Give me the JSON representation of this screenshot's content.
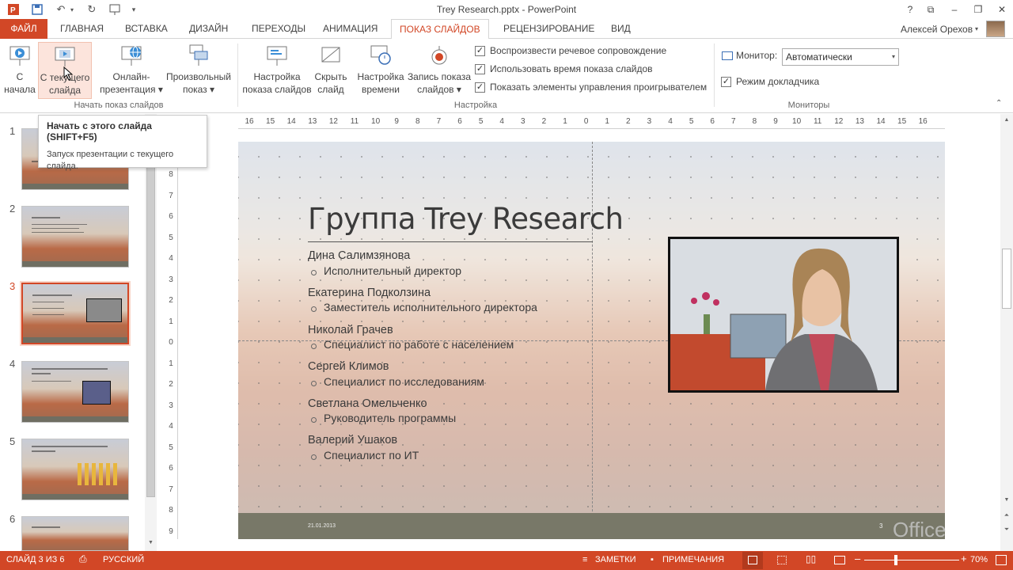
{
  "window": {
    "title": "Trey Research.pptx - PowerPoint"
  },
  "window_controls": {
    "help": "?",
    "restore_ribbon": "⧉",
    "minimize": "–",
    "maximize": "❐",
    "close": "✕"
  },
  "tabs": [
    "ФАЙЛ",
    "ГЛАВНАЯ",
    "ВСТАВКА",
    "ДИЗАЙН",
    "ПЕРЕХОДЫ",
    "АНИМАЦИЯ",
    "ПОКАЗ СЛАЙДОВ",
    "РЕЦЕНЗИРОВАНИЕ",
    "ВИД"
  ],
  "active_tab": "ПОКАЗ СЛАЙДОВ",
  "user": {
    "name": "Алексей Орехов"
  },
  "ribbon": {
    "start": {
      "from_beginning": [
        "С",
        "начала"
      ],
      "from_current": [
        "С текущего",
        "слайда"
      ],
      "online": [
        "Онлайн-",
        "презентация ▾"
      ],
      "custom": [
        "Произвольный",
        "показ ▾"
      ],
      "label": "Начать показ слайдов"
    },
    "setup": {
      "setup_show": [
        "Настройка",
        "показа слайдов"
      ],
      "hide_slide": [
        "Скрыть",
        "слайд"
      ],
      "rehearse": [
        "Настройка",
        "времени"
      ],
      "record": [
        "Запись показа",
        "слайдов ▾"
      ],
      "checks": [
        {
          "label": "Воспроизвести речевое сопровождение",
          "checked": true
        },
        {
          "label": "Использовать время показа слайдов",
          "checked": true
        },
        {
          "label": "Показать элементы управления проигрывателем",
          "checked": true
        }
      ],
      "label": "Настройка"
    },
    "monitors": {
      "monitor_label": "Монитор:",
      "monitor_value": "Автоматически",
      "presenter_label": "Режим докладчика",
      "presenter_checked": true,
      "label": "Мониторы"
    }
  },
  "tooltip": {
    "title": "Начать с этого слайда (SHIFT+F5)",
    "body": "Запуск презентации с текущего слайда."
  },
  "thumbnails": [
    {
      "n": "1"
    },
    {
      "n": "2"
    },
    {
      "n": "3",
      "selected": true
    },
    {
      "n": "4"
    },
    {
      "n": "5"
    },
    {
      "n": "6"
    }
  ],
  "ruler": {
    "top": [
      "16",
      "15",
      "14",
      "13",
      "12",
      "11",
      "10",
      "9",
      "8",
      "7",
      "6",
      "5",
      "4",
      "3",
      "2",
      "1",
      "0",
      "1",
      "2",
      "3",
      "4",
      "5",
      "6",
      "7",
      "8",
      "9",
      "10",
      "11",
      "12",
      "13",
      "14",
      "15",
      "16"
    ],
    "left": [
      "8",
      "7",
      "6",
      "5",
      "4",
      "3",
      "2",
      "1",
      "0",
      "1",
      "2",
      "3",
      "4",
      "5",
      "6",
      "7",
      "8",
      "9"
    ]
  },
  "slide": {
    "title": "Группа Trey Research",
    "people": [
      {
        "name": "Дина Салимзянова",
        "role": "Исполнительный директор"
      },
      {
        "name": "Екатерина Подколзина",
        "role": "Заместитель исполнительного директора"
      },
      {
        "name": "Николай Грачев",
        "role": "Специалист по работе с населением"
      },
      {
        "name": "Сергей Климов",
        "role": "Специалист по исследованиям"
      },
      {
        "name": "Светлана Омельченко",
        "role": "Руководитель программы"
      },
      {
        "name": "Валерий Ушаков",
        "role": "Специалист по ИТ"
      }
    ],
    "date": "21.01.2013",
    "page": "3"
  },
  "status": {
    "slide_info": "СЛАЙД 3 ИЗ 6",
    "language": "РУССКИЙ",
    "notes": "ЗАМЕТКИ",
    "comments": "ПРИМЕЧАНИЯ",
    "zoom": "70%",
    "zoom_level": 0.7
  },
  "office_watermark": "Office",
  "colors": {
    "accent": "#d24726"
  }
}
